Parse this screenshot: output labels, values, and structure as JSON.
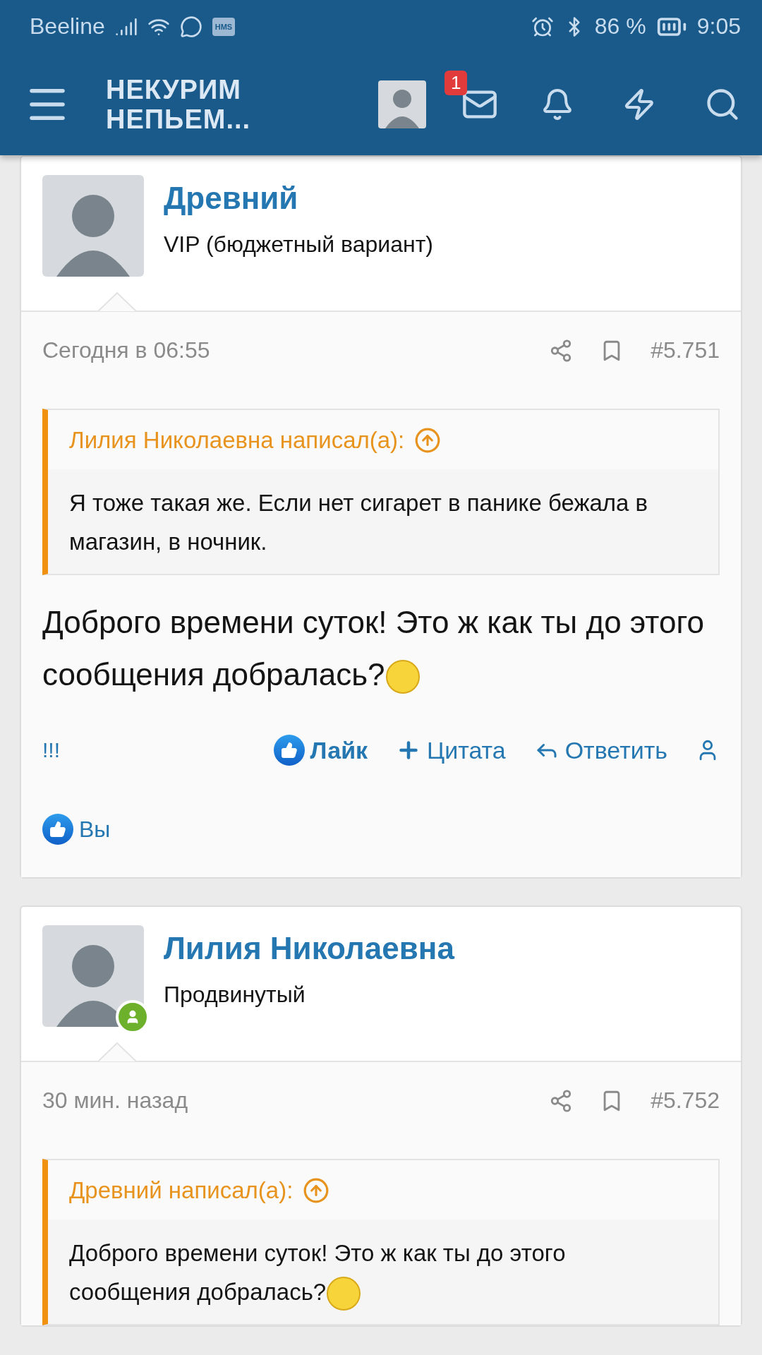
{
  "status_bar": {
    "carrier": "Beeline",
    "hms_label": "HMS",
    "battery": "86 %",
    "time": "9:05"
  },
  "header": {
    "logo_lines": [
      "НЕКУРИМ",
      "НЕПЬЕМ..."
    ],
    "inbox_badge": "1"
  },
  "posts": [
    {
      "author": "Древний",
      "rank": "VIP (бюджетный вариант)",
      "online": false,
      "time": "Сегодня в 06:55",
      "number": "#5.751",
      "quote": {
        "label": "Лилия Николаевна написал(а):",
        "text": "Я тоже такая же. Если нет сигарет в панике бежала в магазин, в ночник.",
        "smiley": false
      },
      "message": {
        "text": "Доброго времени суток! Это ж как ты до этого сообщения добралась?",
        "smiley": true
      },
      "actions": [
        {
          "kind": "text",
          "label": "!!!"
        },
        {
          "kind": "like",
          "label": "Лайк",
          "selected": true
        },
        {
          "kind": "quote",
          "label": "Цитата"
        },
        {
          "kind": "reply",
          "label": "Ответить"
        },
        {
          "kind": "user"
        }
      ],
      "reactions": "Вы"
    },
    {
      "author": "Лилия Николаевна",
      "rank": "Продвинутый",
      "online": true,
      "time": "30 мин. назад",
      "number": "#5.752",
      "quote": {
        "label": "Древний написал(а):",
        "text": "Доброго времени суток! Это ж как ты до этого сообщения добралась?",
        "smiley": true
      }
    }
  ]
}
